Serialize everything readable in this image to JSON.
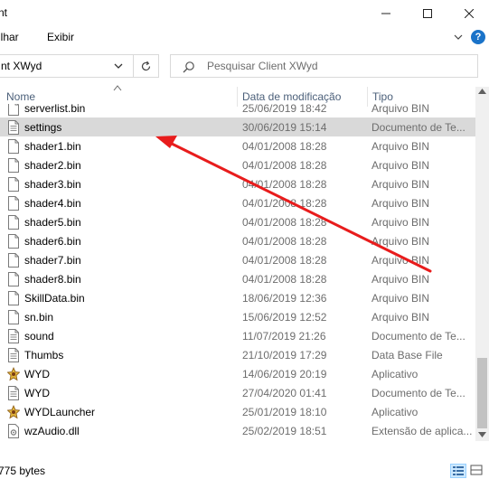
{
  "window": {
    "title": "nt",
    "minimize_icon": "minimize-icon",
    "maximize_icon": "maximize-icon",
    "close_icon": "close-icon"
  },
  "menu": {
    "share": "ilhar",
    "view": "Exibir",
    "help_glyph": "?"
  },
  "address": {
    "path": "nt XWyd"
  },
  "search": {
    "placeholder": "Pesquisar Client XWyd"
  },
  "columns": {
    "name": "Nome",
    "date": "Data de modificação",
    "type": "Tipo"
  },
  "files": [
    {
      "name": "serverlist.bin",
      "date": "25/06/2019 18:42",
      "type": "Arquivo BIN",
      "icon": "blank-file-icon"
    },
    {
      "name": "settings",
      "date": "30/06/2019 15:14",
      "type": "Documento de Te...",
      "icon": "text-document-icon",
      "selected": true
    },
    {
      "name": "shader1.bin",
      "date": "04/01/2008 18:28",
      "type": "Arquivo BIN",
      "icon": "blank-file-icon"
    },
    {
      "name": "shader2.bin",
      "date": "04/01/2008 18:28",
      "type": "Arquivo BIN",
      "icon": "blank-file-icon"
    },
    {
      "name": "shader3.bin",
      "date": "04/01/2008 18:28",
      "type": "Arquivo BIN",
      "icon": "blank-file-icon"
    },
    {
      "name": "shader4.bin",
      "date": "04/01/2008 18:28",
      "type": "Arquivo BIN",
      "icon": "blank-file-icon"
    },
    {
      "name": "shader5.bin",
      "date": "04/01/2008 18:28",
      "type": "Arquivo BIN",
      "icon": "blank-file-icon"
    },
    {
      "name": "shader6.bin",
      "date": "04/01/2008 18:28",
      "type": "Arquivo BIN",
      "icon": "blank-file-icon"
    },
    {
      "name": "shader7.bin",
      "date": "04/01/2008 18:28",
      "type": "Arquivo BIN",
      "icon": "blank-file-icon"
    },
    {
      "name": "shader8.bin",
      "date": "04/01/2008 18:28",
      "type": "Arquivo BIN",
      "icon": "blank-file-icon"
    },
    {
      "name": "SkillData.bin",
      "date": "18/06/2019 12:36",
      "type": "Arquivo BIN",
      "icon": "blank-file-icon"
    },
    {
      "name": "sn.bin",
      "date": "15/06/2019 12:52",
      "type": "Arquivo BIN",
      "icon": "blank-file-icon"
    },
    {
      "name": "sound",
      "date": "11/07/2019 21:26",
      "type": "Documento de Te...",
      "icon": "text-document-icon"
    },
    {
      "name": "Thumbs",
      "date": "21/10/2019 17:29",
      "type": "Data Base File",
      "icon": "text-document-icon"
    },
    {
      "name": "WYD",
      "date": "14/06/2019 20:19",
      "type": "Aplicativo",
      "icon": "app-icon"
    },
    {
      "name": "WYD",
      "date": "27/04/2020 01:41",
      "type": "Documento de Te...",
      "icon": "text-document-icon"
    },
    {
      "name": "WYDLauncher",
      "date": "25/01/2019 18:10",
      "type": "Aplicativo",
      "icon": "app-icon"
    },
    {
      "name": "wzAudio.dll",
      "date": "25/02/2019 18:51",
      "type": "Extensão de aplica...",
      "icon": "dll-file-icon"
    }
  ],
  "status": {
    "text": "775 bytes"
  },
  "annotation": {
    "color": "#e81c1c"
  }
}
